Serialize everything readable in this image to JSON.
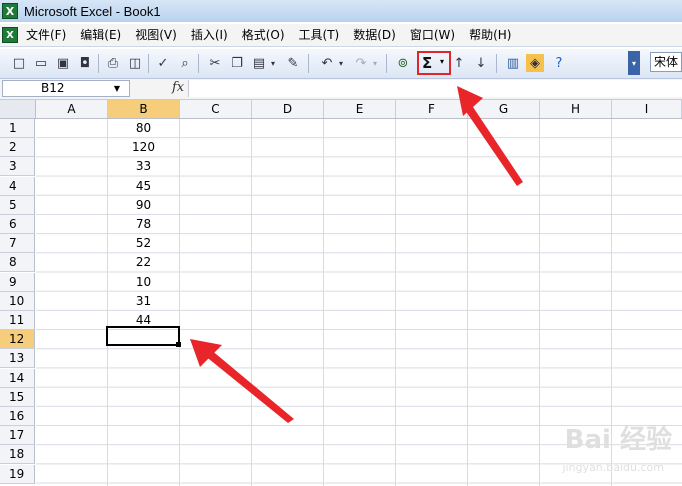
{
  "window": {
    "title": "Microsoft Excel - Book1",
    "app_icon_letter": "X"
  },
  "menu": {
    "items": [
      "文件(F)",
      "编辑(E)",
      "视图(V)",
      "插入(I)",
      "格式(O)",
      "工具(T)",
      "数据(D)",
      "窗口(W)",
      "帮助(H)"
    ]
  },
  "toolbar": {
    "autosum_label": "Σ",
    "font_name": "宋体"
  },
  "formula_bar": {
    "name_box": "B12",
    "fx_label": "fx",
    "formula": ""
  },
  "sheet": {
    "columns": [
      "A",
      "B",
      "C",
      "D",
      "E",
      "F",
      "G",
      "H",
      "I"
    ],
    "rows": [
      "1",
      "2",
      "3",
      "4",
      "5",
      "6",
      "7",
      "8",
      "9",
      "10",
      "11",
      "12",
      "13",
      "14",
      "15",
      "16",
      "17",
      "18",
      "19"
    ],
    "selected_row": "12",
    "selected_column": "B",
    "column_b_values": [
      "80",
      "120",
      "33",
      "45",
      "90",
      "78",
      "52",
      "22",
      "10",
      "31",
      "44"
    ]
  },
  "watermark": {
    "text": "Bai 经验",
    "sub": "jingyan.baidu.com"
  },
  "colors": {
    "highlight": "#e0262a",
    "selected_header": "#f6cd7b",
    "excel_green": "#1f7a3a"
  }
}
